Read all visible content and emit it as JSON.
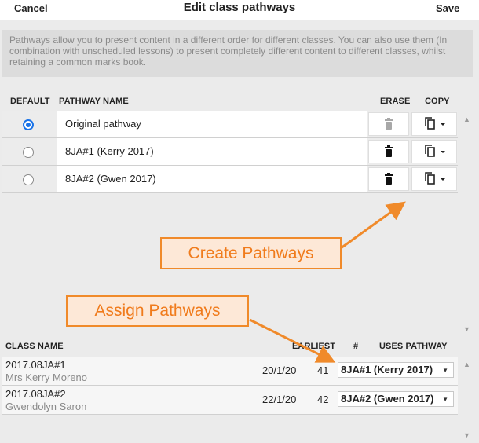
{
  "header": {
    "cancel_label": "Cancel",
    "title": "Edit class pathways",
    "save_label": "Save"
  },
  "info_text": "Pathways allow you to present content in a different order for different classes. You can also use them (In combination with unscheduled lessons) to present completely different content to different classes, whilst retaining a common marks book.",
  "pathways_table": {
    "headers": {
      "default": "DEFAULT",
      "name": "PATHWAY NAME",
      "erase": "ERASE",
      "copy": "COPY"
    },
    "rows": [
      {
        "name": "Original pathway",
        "default": true,
        "erase_enabled": false
      },
      {
        "name": "8JA#1 (Kerry 2017)",
        "default": false,
        "erase_enabled": true
      },
      {
        "name": "8JA#2 (Gwen 2017)",
        "default": false,
        "erase_enabled": true
      }
    ]
  },
  "classes_table": {
    "headers": {
      "class_name": "CLASS NAME",
      "earliest": "EARLIEST",
      "number": "#",
      "uses_pathway": "USES PATHWAY"
    },
    "rows": [
      {
        "class": "2017.08JA#1",
        "teacher": "Mrs Kerry Moreno",
        "earliest": "20/1/20",
        "number": "41",
        "pathway": "8JA#1 (Kerry 2017)"
      },
      {
        "class": "2017.08JA#2",
        "teacher": "Gwendolyn Saron",
        "earliest": "22/1/20",
        "number": "42",
        "pathway": "8JA#2 (Gwen 2017)"
      }
    ]
  },
  "annotations": {
    "create": "Create Pathways",
    "assign": "Assign Pathways"
  },
  "colors": {
    "accent": "#1a73e8",
    "callout_border": "#f08a2a",
    "callout_text": "#f07b1c",
    "callout_fill": "#fde8d7"
  },
  "icons": {
    "erase": "trash-icon",
    "copy": "copy-icon",
    "dropdown": "caret-down-icon"
  }
}
